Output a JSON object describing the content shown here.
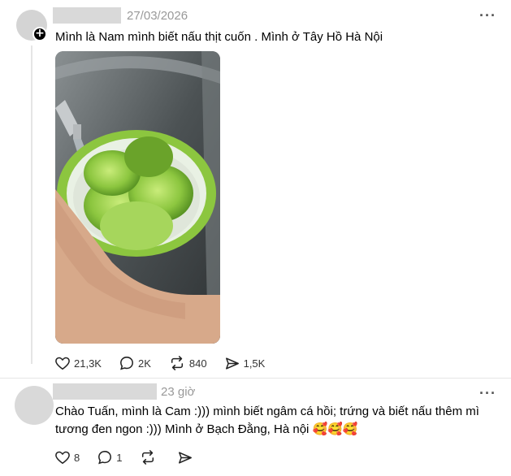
{
  "post": {
    "timestamp": "27/03/2026",
    "text": "Mình là Nam mình biết nấu thịt cuốn . Mình ở Tây Hồ Hà Nội",
    "more_label": "···",
    "plus_label": "+",
    "media_icon": "mute-icon",
    "stats": {
      "likes": "21,3K",
      "comments": "2K",
      "reposts": "840",
      "shares": "1,5K"
    }
  },
  "reply": {
    "timestamp": "23 giờ",
    "text": "Chào Tuấn, mình là Cam :))) mình biết ngâm cá hồi; trứng và biết nấu thêm mì tương đen ngon :))) Mình ở Bạch Đằng, Hà nội 🥰🥰🥰",
    "more_label": "···",
    "stats": {
      "likes": "8",
      "comments": "1"
    }
  },
  "colors": {
    "text": "#000000",
    "muted": "#999999",
    "placeholder": "#d9d9d9",
    "basket": "#8cc63f"
  }
}
